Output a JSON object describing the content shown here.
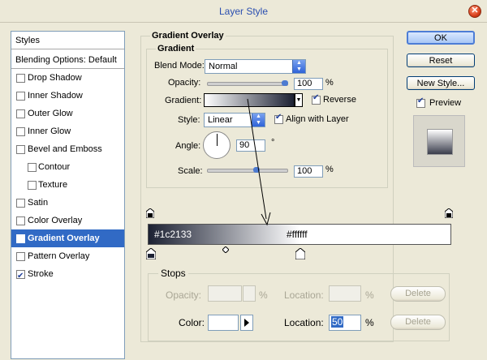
{
  "window": {
    "title": "Layer Style"
  },
  "sidebar": {
    "header": "Styles",
    "blending": "Blending Options: Default",
    "items": [
      {
        "label": "Drop Shadow",
        "checked": false,
        "indent": false,
        "selected": false
      },
      {
        "label": "Inner Shadow",
        "checked": false,
        "indent": false,
        "selected": false
      },
      {
        "label": "Outer Glow",
        "checked": false,
        "indent": false,
        "selected": false
      },
      {
        "label": "Inner Glow",
        "checked": false,
        "indent": false,
        "selected": false
      },
      {
        "label": "Bevel and Emboss",
        "checked": false,
        "indent": false,
        "selected": false
      },
      {
        "label": "Contour",
        "checked": false,
        "indent": true,
        "selected": false
      },
      {
        "label": "Texture",
        "checked": false,
        "indent": true,
        "selected": false
      },
      {
        "label": "Satin",
        "checked": false,
        "indent": false,
        "selected": false
      },
      {
        "label": "Color Overlay",
        "checked": false,
        "indent": false,
        "selected": false
      },
      {
        "label": "Gradient Overlay",
        "checked": true,
        "indent": false,
        "selected": true
      },
      {
        "label": "Pattern Overlay",
        "checked": false,
        "indent": false,
        "selected": false
      },
      {
        "label": "Stroke",
        "checked": true,
        "indent": false,
        "selected": false
      }
    ]
  },
  "gradient_overlay": {
    "section_title": "Gradient Overlay",
    "group_title": "Gradient",
    "blend_mode_label": "Blend Mode:",
    "blend_mode_value": "Normal",
    "opacity_label": "Opacity:",
    "opacity_value": "100",
    "opacity_percent": 100,
    "gradient_label": "Gradient:",
    "reverse_label": "Reverse",
    "reverse_checked": true,
    "style_label": "Style:",
    "style_value": "Linear",
    "align_label": "Align with Layer",
    "align_checked": true,
    "angle_label": "Angle:",
    "angle_value": "90",
    "scale_label": "Scale:",
    "scale_value": "100",
    "percent": "%",
    "degree": "°"
  },
  "gradient_editor": {
    "color_left": "#1c2133",
    "color_right": "#ffffff",
    "label_left": "#1c2133",
    "label_right": "#ffffff",
    "stops_title": "Stops",
    "opacity_label": "Opacity:",
    "location_label": "Location:",
    "color_label": "Color:",
    "location_value": "50",
    "percent": "%",
    "delete_label": "Delete"
  },
  "buttons": {
    "ok": "OK",
    "reset": "Reset",
    "new_style": "New Style...",
    "preview_label": "Preview",
    "preview_checked": true
  },
  "colors": {
    "accent": "#316ac5",
    "title": "#2b4fb0"
  }
}
